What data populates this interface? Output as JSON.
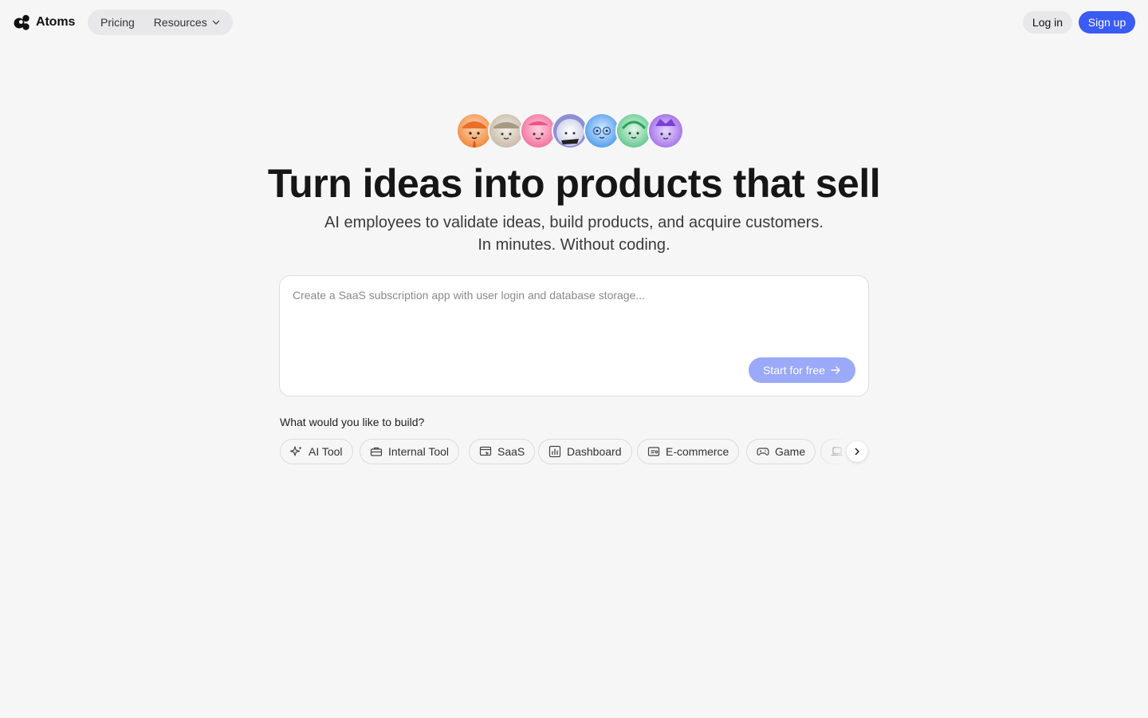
{
  "header": {
    "logo_text": "Atoms",
    "nav": {
      "pricing": "Pricing",
      "resources": "Resources"
    },
    "login_label": "Log in",
    "signup_label": "Sign up"
  },
  "colors": {
    "accent": "#3b5bf5",
    "accent_disabled": "#9aa9f8",
    "background": "#f6f6f7"
  },
  "avatars": [
    {
      "name": "avatar-orange",
      "color": "#f59a52"
    },
    {
      "name": "avatar-beige",
      "color": "#cbbfae"
    },
    {
      "name": "avatar-pink",
      "color": "#f37aa4"
    },
    {
      "name": "avatar-white",
      "color": "#dfe1f0"
    },
    {
      "name": "avatar-blue",
      "color": "#5aa8f0"
    },
    {
      "name": "avatar-green",
      "color": "#6dd097"
    },
    {
      "name": "avatar-purple",
      "color": "#a070e8"
    }
  ],
  "hero": {
    "title": "Turn ideas into products that sell",
    "subtitle_line1": "AI employees to validate ideas, build products, and acquire customers.",
    "subtitle_line2": "In minutes. Without coding."
  },
  "prompt": {
    "placeholder": "Create a SaaS subscription app with user login and database storage...",
    "value": "",
    "start_label": "Start for free"
  },
  "build": {
    "question": "What would you like to build?",
    "chips": [
      {
        "label": "AI Tool",
        "icon": "sparkle-icon"
      },
      {
        "label": "Internal Tool",
        "icon": "toolbox-icon"
      },
      {
        "label": "SaaS",
        "icon": "browser-cursor-icon"
      },
      {
        "label": "Dashboard",
        "icon": "bar-chart-icon"
      },
      {
        "label": "E-commerce",
        "icon": "store-icon"
      },
      {
        "label": "Game",
        "icon": "gamepad-icon"
      },
      {
        "label": "",
        "icon": "laptop-icon"
      }
    ]
  }
}
